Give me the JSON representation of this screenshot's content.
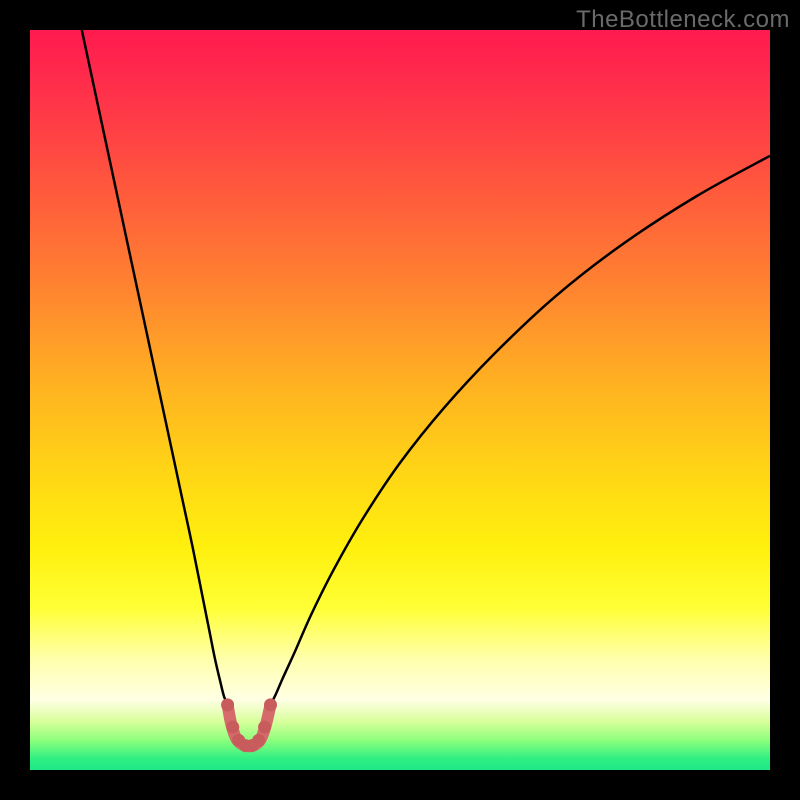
{
  "watermark": "TheBottleneck.com",
  "chart_data": {
    "type": "line",
    "title": "",
    "xlabel": "",
    "ylabel": "",
    "xlim": [
      0,
      100
    ],
    "ylim": [
      0,
      100
    ],
    "frame": {
      "outer_w": 800,
      "outer_h": 800,
      "inner_x": 30,
      "inner_y": 30,
      "inner_w": 740,
      "inner_h": 740
    },
    "gradient_stops": [
      {
        "offset": 0.0,
        "color": "#ff1a4f"
      },
      {
        "offset": 0.1,
        "color": "#ff3549"
      },
      {
        "offset": 0.22,
        "color": "#ff5a3c"
      },
      {
        "offset": 0.35,
        "color": "#ff8430"
      },
      {
        "offset": 0.48,
        "color": "#ffb221"
      },
      {
        "offset": 0.6,
        "color": "#ffd615"
      },
      {
        "offset": 0.7,
        "color": "#fff00e"
      },
      {
        "offset": 0.78,
        "color": "#ffff35"
      },
      {
        "offset": 0.85,
        "color": "#ffffac"
      },
      {
        "offset": 0.905,
        "color": "#ffffe4"
      },
      {
        "offset": 0.935,
        "color": "#d7ff9a"
      },
      {
        "offset": 0.96,
        "color": "#8cff7d"
      },
      {
        "offset": 0.985,
        "color": "#2fef82"
      },
      {
        "offset": 1.0,
        "color": "#1fe887"
      }
    ],
    "series": [
      {
        "name": "left_branch",
        "stroke": "#000000",
        "stroke_width": 2.5,
        "x": [
          7.0,
          8.5,
          10.0,
          11.5,
          13.0,
          14.5,
          16.0,
          17.5,
          19.0,
          20.5,
          22.0,
          23.2,
          24.2,
          25.0,
          25.7,
          26.2,
          26.7
        ],
        "y": [
          100.0,
          93.0,
          86.0,
          79.0,
          72.0,
          65.0,
          58.0,
          51.0,
          44.0,
          37.0,
          30.0,
          24.0,
          19.0,
          15.0,
          12.0,
          10.0,
          8.8
        ]
      },
      {
        "name": "right_branch",
        "stroke": "#000000",
        "stroke_width": 2.5,
        "x": [
          32.5,
          33.2,
          34.2,
          35.8,
          38.0,
          41.0,
          45.0,
          50.0,
          56.0,
          63.0,
          71.0,
          80.0,
          90.0,
          100.0
        ],
        "y": [
          8.8,
          10.2,
          12.5,
          16.0,
          21.0,
          27.0,
          34.0,
          41.5,
          49.0,
          56.5,
          64.0,
          71.0,
          77.5,
          83.0
        ]
      },
      {
        "name": "valley_marker",
        "stroke": "#d46a6a",
        "stroke_width": 12,
        "linecap": "round",
        "linejoin": "round",
        "x": [
          26.7,
          27.2,
          27.9,
          28.8,
          29.6,
          30.4,
          31.2,
          31.9,
          32.5
        ],
        "y": [
          8.8,
          6.2,
          4.2,
          3.4,
          3.2,
          3.4,
          4.2,
          6.2,
          8.8
        ]
      }
    ],
    "marker_dots": {
      "color": "#c85c5c",
      "radius": 6.5,
      "x": [
        26.7,
        27.4,
        28.2,
        29.1,
        30.0,
        30.9,
        31.7,
        32.5
      ],
      "y": [
        8.8,
        5.8,
        4.0,
        3.3,
        3.3,
        4.0,
        5.8,
        8.8
      ]
    }
  }
}
